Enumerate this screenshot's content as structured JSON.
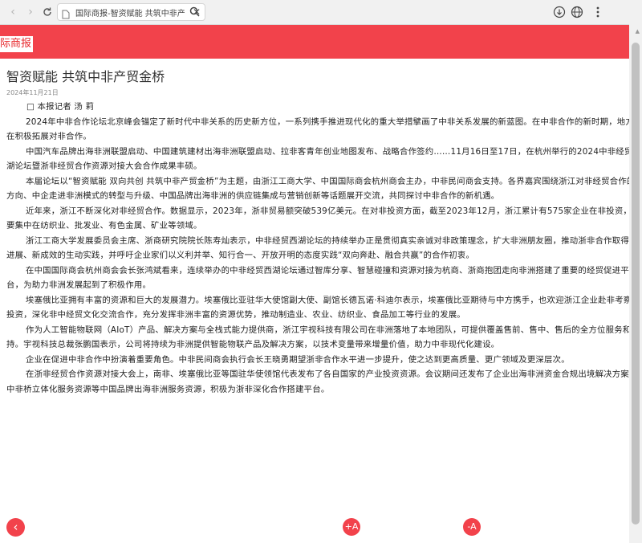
{
  "browser": {
    "tab_title": "国际商报-智资赋能 共筑中非产",
    "tab_close": "✕"
  },
  "site": {
    "logo_text": "际商报",
    "brand_color": "#f2424b"
  },
  "article": {
    "title": "智资赋能  共筑中非产贸金桥",
    "date": "2024年11月21日",
    "paragraphs": [
      "□  本报记者  汤  莉",
      "2024年中非合作论坛北京峰会锚定了新时代中非关系的历史新方位，一系列携手推进现代化的重大举措擘画了中非关系发展的新蓝图。在中非合作的新时期，地方也在积极拓展对非合作。",
      "中国汽车品牌出海非洲联盟启动、中国建筑建材出海非洲联盟启动、拉非客青年创业地图发布、战略合作签约……11月16日至17日，在杭州举行的2024中非经贸西湖论坛暨浙非经贸合作资源对接大会合作成果丰硕。",
      "本届论坛以“智资赋能  双向共创  共筑中非产贸金桥”为主题，由浙江工商大学、中国国际商会杭州商会主办，中非民间商会支持。各界嘉宾围绕浙江对非经贸合作的新方向、中企走进非洲模式的转型与升级、中国品牌出海非洲的供应链集成与营销创新等话题展开交流，共同探讨中非合作的新机遇。",
      "近年来，浙江不断深化对非经贸合作。数据显示，2023年，浙非贸易额突破539亿美元。在对非投资方面，截至2023年12月，浙江累计有575家企业在非投资，主要集中在纺织业、批发业、有色金属、矿业等领域。",
      "浙江工商大学发展委员会主席、浙商研究院院长陈寿灿表示，中非经贸西湖论坛的持续举办正是贯彻真实亲诚对非政策理念，扩大非洲朋友圈，推动浙非合作取得新进展、新成效的生动实践，并呼吁企业家们以义利并举、知行合一、开放开明的态度实践“双向奔赴、融合共赢”的合作初衷。",
      "在中国国际商会杭州商会会长张鸿斌看来，连续举办的中非经贸西湖论坛通过智库分享、智慧碰撞和资源对接为杭商、浙商抱团走向非洲搭建了重要的经贸促进平台，为助力非洲发展起到了积极作用。",
      "埃塞俄比亚拥有丰富的资源和巨大的发展潜力。埃塞俄比亚驻华大使馆副大使、副馆长德瓦诺·科迪尔表示，埃塞俄比亚期待与中方携手，也欢迎浙江企业赴非考察、投资，深化非中经贸文化交流合作，充分发挥非洲丰富的资源优势，推动制造业、农业、纺织业、食品加工等行业的发展。",
      "作为人工智能物联网（AIoT）产品、解决方案与全栈式能力提供商，浙江宇视科技有限公司在非洲落地了本地团队，可提供覆盖售前、售中、售后的全方位服务和支持。宇视科技总裁张鹏国表示，公司将持续为非洲提供智能物联产品及解决方案，以技术变量带来增量价值，助力中非现代化建设。",
      "企业在促进中非合作中扮演着重要角色。中非民间商会执行会长王晓勇期望浙非合作水平进一步提升，使之达到更高质量、更广领域及更深层次。",
      "在浙非经贸合作资源对接大会上，南非、埃塞俄比亚等国驻华使领馆代表发布了各自国家的产业投资资源。会议期间还发布了企业出海非洲资金合规出境解决方案、中非桥立体化服务资源等中国品牌出海非洲服务资源，积极为浙非深化合作搭建平台。"
    ]
  },
  "footer": {
    "back_label": "‹",
    "font_increase_label": "+A",
    "font_decrease_label": "-A"
  }
}
